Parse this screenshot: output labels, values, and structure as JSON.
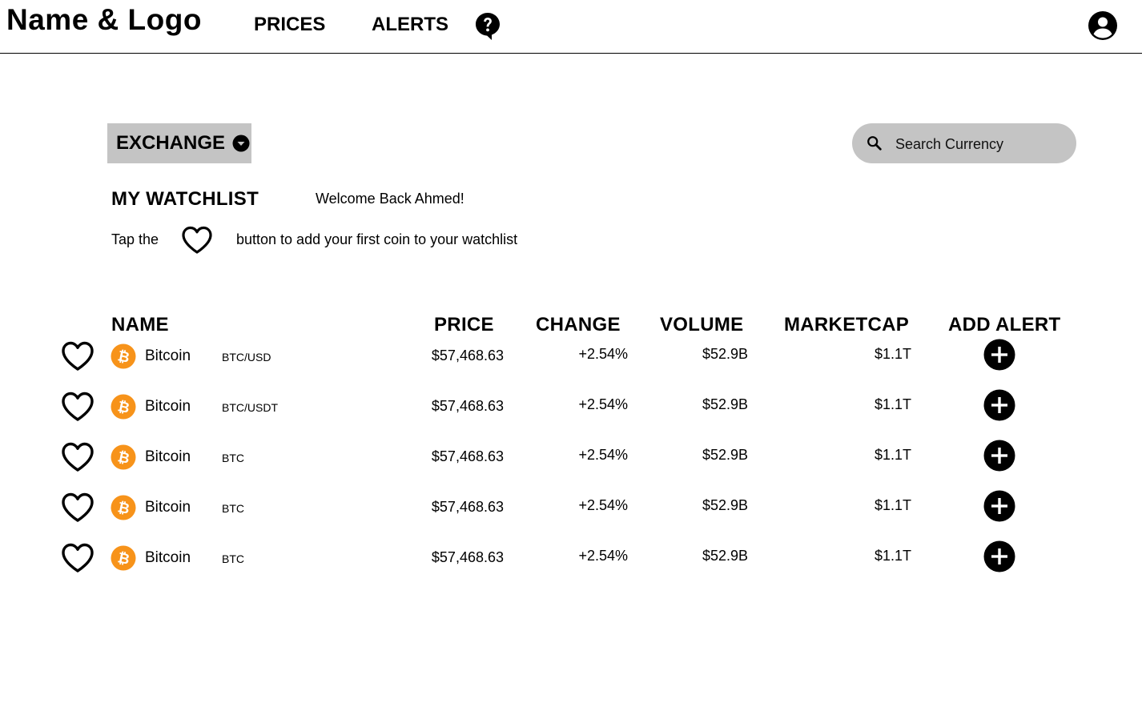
{
  "header": {
    "brand": "Name & Logo",
    "nav": [
      {
        "label": "PRICES"
      },
      {
        "label": "ALERTS"
      }
    ],
    "help_icon": "question-bubble-icon",
    "account_icon": "account-circle-icon"
  },
  "toolbar": {
    "exchange_label": "EXCHANGE",
    "search_placeholder": "Search Currency"
  },
  "watchlist": {
    "title": "MY WATCHLIST",
    "welcome": "Welcome Back Ahmed!",
    "hint_before": "Tap the",
    "hint_after": "button to add your first coin to your watchlist"
  },
  "table": {
    "columns": [
      "NAME",
      "PRICE",
      "CHANGE",
      "VOLUME",
      "MARKETCAP",
      "ADD ALERT"
    ],
    "rows": [
      {
        "name": "Bitcoin",
        "pair": "BTC/USD",
        "price": "$57,468.63",
        "change": "+2.54%",
        "volume": "$52.9B",
        "marketcap": "$1.1T"
      },
      {
        "name": "Bitcoin",
        "pair": "BTC/USDT",
        "price": "$57,468.63",
        "change": "+2.54%",
        "volume": "$52.9B",
        "marketcap": "$1.1T"
      },
      {
        "name": "Bitcoin",
        "pair": "BTC",
        "price": "$57,468.63",
        "change": "+2.54%",
        "volume": "$52.9B",
        "marketcap": "$1.1T"
      },
      {
        "name": "Bitcoin",
        "pair": "BTC",
        "price": "$57,468.63",
        "change": "+2.54%",
        "volume": "$52.9B",
        "marketcap": "$1.1T"
      },
      {
        "name": "Bitcoin",
        "pair": "BTC",
        "price": "$57,468.63",
        "change": "+2.54%",
        "volume": "$52.9B",
        "marketcap": "$1.1T"
      }
    ]
  },
  "colors": {
    "accent_bitcoin": "#F7931A",
    "control_gray": "#C4C4C4",
    "text": "#000000"
  }
}
